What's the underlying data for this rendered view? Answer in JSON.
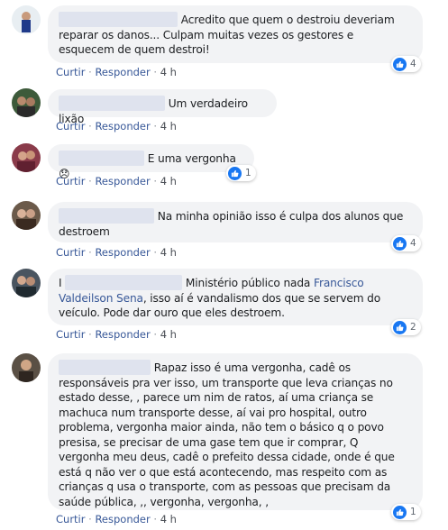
{
  "comments": [
    {
      "text": "Acredito que quem o destroiu deveriam reparar os danos... Culpam muitas vezes os gestores e esquecem de quem destroi!",
      "actions": {
        "like": "Curtir",
        "reply": "Responder",
        "time": "4 h"
      },
      "reactions": "4"
    },
    {
      "text": "Um verdadeiro lixão",
      "actions": {
        "like": "Curtir",
        "reply": "Responder",
        "time": "4 h"
      }
    },
    {
      "text": "E uma vergonha",
      "emoji": "😞",
      "actions": {
        "like": "Curtir",
        "reply": "Responder",
        "time": "4 h"
      },
      "reactions": "1"
    },
    {
      "text": "Na minha opinião isso é culpa dos alunos que destroem",
      "actions": {
        "like": "Curtir",
        "reply": "Responder",
        "time": "4 h"
      },
      "reactions": "4"
    },
    {
      "prefix": "I",
      "text_before": "Ministério público nada",
      "mention": "Francisco Valdeilson Sena",
      "text_after": ", isso aí é vandalismo dos que se servem do veículo. Pode dar ouro que eles destroem.",
      "actions": {
        "like": "Curtir",
        "reply": "Responder",
        "time": "4 h"
      },
      "reactions": "2"
    },
    {
      "text": "Rapaz isso é uma vergonha, cadê os responsáveis pra ver isso, um transporte que leva crianças no estado desse, , parece um nim de ratos, aí uma criança se machuca num transporte desse, aí vai pro hospital, outro problema, vergonha maior ainda, não tem o básico q o povo presisa, se precisar de uma gase tem que ir comprar, Q vergonha meu deus, cadê o prefeito dessa cidade, onde é que está q não ver o que está acontecendo, mas respeito com as crianças q usa o transporte, com as pessoas que precisam da saúde pública, ,, vergonha, vergonha, ,",
      "actions": {
        "like": "Curtir",
        "reply": "Responder",
        "time": "4 h"
      },
      "reactions": "1"
    }
  ],
  "colors": {
    "bubble": "#f2f3f5",
    "link": "#385898",
    "like": "#1877f2",
    "redaction": "#dfe3ee"
  }
}
